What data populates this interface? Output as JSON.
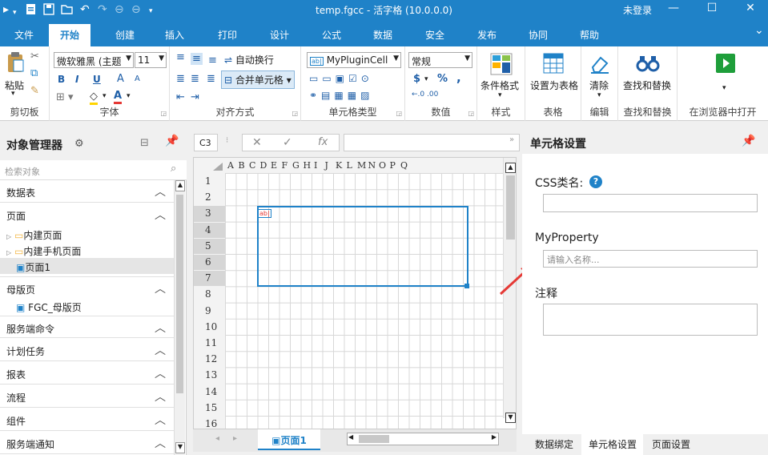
{
  "window": {
    "title": "temp.fgcc - 活字格 (10.0.0.0)",
    "login": "未登录",
    "minimize_icon": "minimize-icon",
    "maximize_icon": "maximize-icon",
    "close_icon": "close-icon"
  },
  "tabs": [
    "文件",
    "开始",
    "创建",
    "插入",
    "打印",
    "设计",
    "公式",
    "数据",
    "安全",
    "发布",
    "协同",
    "帮助"
  ],
  "active_tab": "开始",
  "ribbon": {
    "clipboard": {
      "paste": "粘贴",
      "label": "剪切板"
    },
    "font": {
      "family": "微软雅黑 (主题",
      "size": "11",
      "bold": "B",
      "italic": "I",
      "underline": "U",
      "grow": "A",
      "shrink": "A",
      "fill": "◇",
      "color": "A",
      "label": "字体"
    },
    "align": {
      "wrap": "自动换行",
      "merge": "合并单元格",
      "label": "对齐方式"
    },
    "celltype": {
      "value": "MyPluginCell",
      "label": "单元格类型"
    },
    "number": {
      "format": "常规",
      "currency": "$",
      "percent": "%",
      "comma": ",",
      "inc": "←.0 .00",
      "label": "数值"
    },
    "styles": {
      "conditional": "条件格式",
      "label": "样式"
    },
    "table": {
      "as_table": "设置为表格",
      "label": "表格"
    },
    "edit": {
      "clear": "清除",
      "label": "编辑"
    },
    "find": {
      "find_replace": "查找和替换",
      "label": "查找和替换"
    },
    "run": {
      "open_browser": "在浏览器中打开"
    }
  },
  "left_panel": {
    "title": "对象管理器",
    "search_placeholder": "检索对象",
    "sections": [
      {
        "label": "数据表"
      },
      {
        "label": "页面"
      },
      {
        "label": "母版页"
      },
      {
        "label": "服务端命令"
      },
      {
        "label": "计划任务"
      },
      {
        "label": "报表"
      },
      {
        "label": "流程"
      },
      {
        "label": "组件"
      },
      {
        "label": "服务端通知"
      }
    ],
    "page_items": [
      "内建页面",
      "内建手机页面",
      "页面1"
    ],
    "master_items": [
      "FGC_母版页"
    ]
  },
  "formula_bar": {
    "cell_ref": "C3",
    "cancel": "✕",
    "enter": "✓",
    "fx": "fx",
    "value": ""
  },
  "sheet": {
    "columns": [
      "A",
      "B",
      "C",
      "D",
      "E",
      "F",
      "G",
      "H",
      "I",
      "J",
      "K",
      "L",
      "M",
      "N",
      "O",
      "P",
      "Q"
    ],
    "rows": [
      "1",
      "2",
      "3",
      "4",
      "5",
      "6",
      "7",
      "8",
      "9",
      "10",
      "11",
      "12",
      "13",
      "14",
      "15",
      "16"
    ],
    "cell_badge": "ab|",
    "active_tab": "页面1"
  },
  "right_panel": {
    "title": "单元格设置",
    "css_label": "CSS类名:",
    "help": "?",
    "myproperty_label": "MyProperty",
    "myproperty_placeholder": "请输入名称...",
    "note_label": "注释",
    "bottom_tabs": [
      "数据绑定",
      "单元格设置",
      "页面设置"
    ]
  },
  "colors": {
    "accent": "#1f82c8",
    "selection": "#1f82c8",
    "arrow": "#e53935",
    "run_green": "#1e9e3a"
  }
}
